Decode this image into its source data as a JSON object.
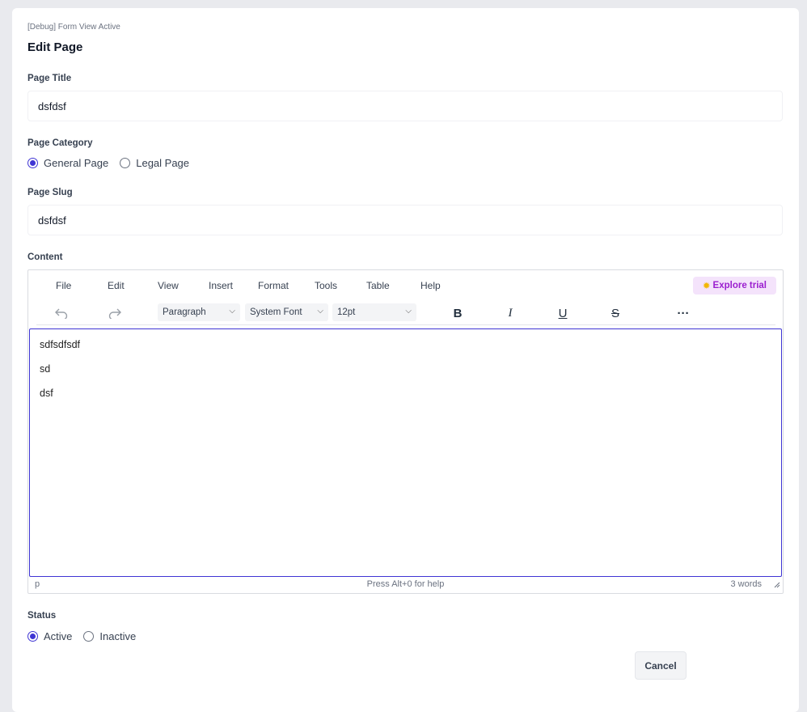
{
  "debug_text": "[Debug] Form View Active",
  "page_heading": "Edit Page",
  "fields": {
    "title_label": "Page Title",
    "title_value": "dsfdsf",
    "category_label": "Page Category",
    "category_options": [
      "General Page",
      "Legal Page"
    ],
    "category_selected": "General Page",
    "slug_label": "Page Slug",
    "slug_value": "dsfdsf",
    "content_label": "Content",
    "status_label": "Status",
    "status_options": [
      "Active",
      "Inactive"
    ],
    "status_selected": "Active"
  },
  "editor": {
    "menu": [
      "File",
      "Edit",
      "View",
      "Insert",
      "Format",
      "Tools",
      "Table",
      "Help"
    ],
    "trial_label": "Explore trial",
    "block_format": "Paragraph",
    "font_family": "System Font",
    "font_size": "12pt",
    "paragraphs": [
      "sdfsdfsdf",
      "sd",
      "dsf"
    ],
    "status_path": "p",
    "status_help": "Press Alt+0 for help",
    "word_count": "3 words",
    "icons": [
      "undo-icon",
      "redo-icon",
      "bold-icon",
      "italic-icon",
      "underline-icon",
      "strikethrough-icon",
      "more-icon"
    ]
  },
  "buttons": {
    "cancel": "Cancel"
  },
  "colors": {
    "accent": "#3f35d4",
    "trial_text": "#9b1fcf",
    "trial_bg": "#f4e3fb",
    "background": "#e9eaee"
  }
}
